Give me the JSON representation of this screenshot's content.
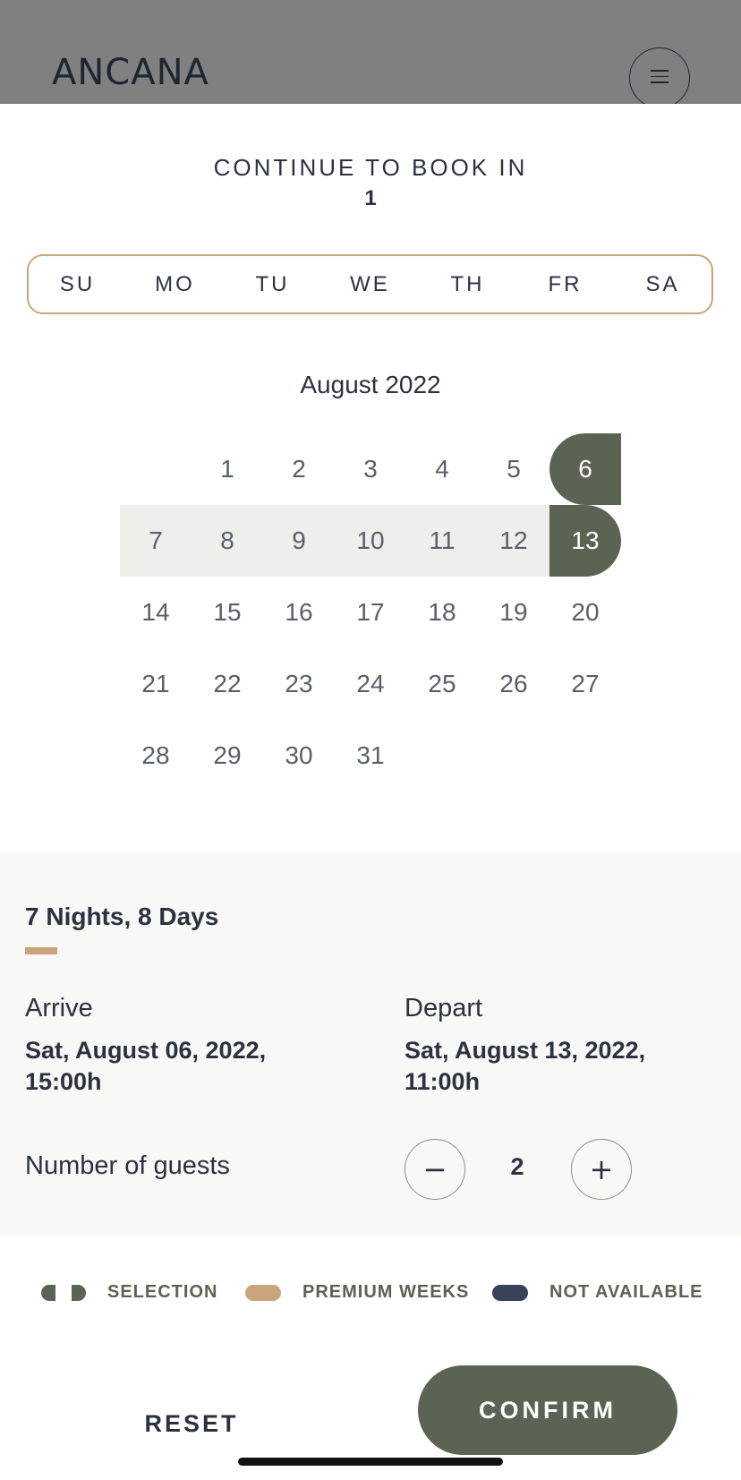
{
  "header": {
    "logo": "ANCANA",
    "menu_icon": "hamburger-icon"
  },
  "booking": {
    "continue_label": "CONTINUE TO BOOK IN",
    "count": "1"
  },
  "calendar": {
    "weekdays": [
      "SU",
      "MO",
      "TU",
      "WE",
      "TH",
      "FR",
      "SA"
    ],
    "month_title": "August 2022",
    "first_weekday_index": 1,
    "days": [
      "1",
      "2",
      "3",
      "4",
      "5",
      "6",
      "7",
      "8",
      "9",
      "10",
      "11",
      "12",
      "13",
      "14",
      "15",
      "16",
      "17",
      "18",
      "19",
      "20",
      "21",
      "22",
      "23",
      "24",
      "25",
      "26",
      "27",
      "28",
      "29",
      "30",
      "31"
    ],
    "selected_start": 6,
    "selected_end": 13
  },
  "summary": {
    "nights": "7 Nights, 8 Days",
    "arrive_label": "Arrive",
    "arrive_value": "Sat, August 06, 2022, 15:00h",
    "depart_label": "Depart",
    "depart_value": "Sat, August 13, 2022, 11:00h",
    "guests_label": "Number of guests",
    "guests_count": "2",
    "minus_symbol": "−",
    "plus_symbol": "+"
  },
  "legend": {
    "selection": "SELECTION",
    "premium": "PREMIUM WEEKS",
    "not_available": "NOT AVAILABLE"
  },
  "actions": {
    "reset": "RESET",
    "confirm": "CONFIRM"
  },
  "colors": {
    "accent_green": "#5b6452",
    "accent_gold": "#c9a57c",
    "not_available": "#37435a",
    "text": "#2c3140"
  }
}
